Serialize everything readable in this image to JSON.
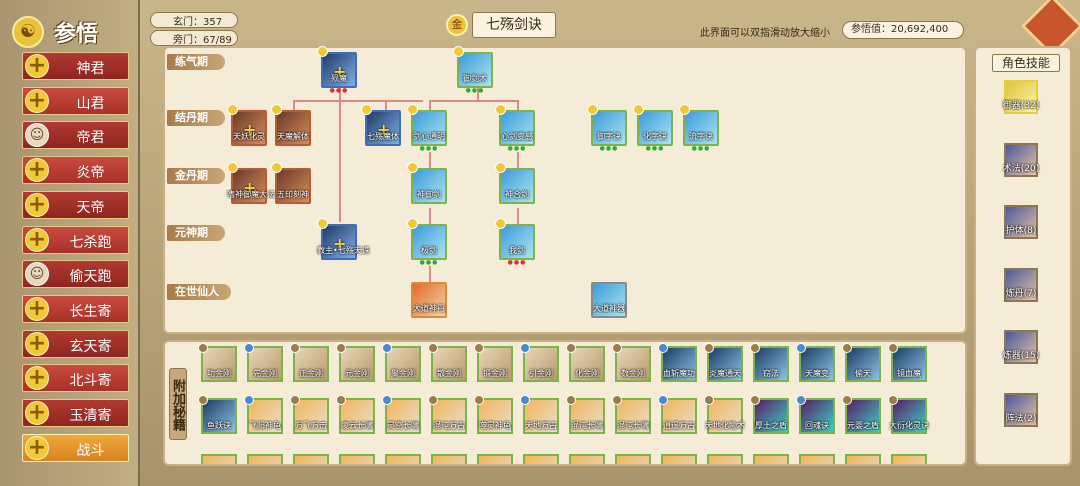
{
  "sidebar": {
    "title": "参悟",
    "items": [
      {
        "label": "神君",
        "icon": "plus-icon"
      },
      {
        "label": "山君",
        "icon": "plus-icon"
      },
      {
        "label": "帝君",
        "icon": "avatar-icon"
      },
      {
        "label": "炎帝",
        "icon": "plus-icon"
      },
      {
        "label": "天帝",
        "icon": "plus-icon"
      },
      {
        "label": "七杀跑",
        "icon": "plus-icon"
      },
      {
        "label": "偷天跑",
        "icon": "avatar-icon"
      },
      {
        "label": "长生寄",
        "icon": "plus-icon"
      },
      {
        "label": "玄天寄",
        "icon": "plus-icon"
      },
      {
        "label": "北斗寄",
        "icon": "plus-icon"
      },
      {
        "label": "玉清寄",
        "icon": "plus-icon"
      },
      {
        "label": "战斗",
        "icon": "plus-icon",
        "active": true
      }
    ]
  },
  "header": {
    "xuanmen": "玄门：357",
    "pangmen": "旁门：67/89",
    "coin_label": "金",
    "title": "七殇剑诀",
    "hint": "此界面可以双指滑动放大缩小",
    "wudao": "参悟值：20,692,400"
  },
  "tree": {
    "tiers": [
      "练气期",
      "结丹期",
      "金丹期",
      "元神期",
      "在世仙人"
    ],
    "nodes": {
      "n1": "殒魔",
      "n2": "御剑术",
      "n3": "天妖化灵",
      "n4": "天魔解体",
      "n5": "七殇魔体",
      "n6": "剑心通明",
      "n7": "心剑变感",
      "n8": "御字诀",
      "n9": "化字诀",
      "n10": "流字诀",
      "n11": "嗜神御魔大法",
      "n12": "五印刻神",
      "n13": "神御剑",
      "n14": "神合剑",
      "n15": "教主•七殇天诛",
      "n16": "极剑",
      "n17": "我剑",
      "n18": "大道神丹",
      "n19": "大道神器"
    }
  },
  "right_panel": {
    "title": "角色技能",
    "skills": [
      {
        "label": "御器(32)",
        "selected": true
      },
      {
        "label": "术法(20)"
      },
      {
        "label": "护体(8)"
      },
      {
        "label": "炼丹(7)"
      },
      {
        "label": "炼器(15)"
      },
      {
        "label": "阵法(2)"
      }
    ]
  },
  "bottom": {
    "tab": "附加秘籍",
    "row1": [
      "功金刚",
      "先金刚",
      "正金刚",
      "元金刚",
      "聚金刚",
      "散金刚",
      "锻金刚",
      "引金刚",
      "化金刚",
      "数金刚",
      "血斩魔功",
      "炎魔通天",
      "窃法",
      "天魔变",
      "偷天",
      "镜血魔"
    ],
    "row2": [
      "鱼跃诀",
      "飞阳神龟",
      "万飞万击",
      "凌云长啸",
      "灵空长啸",
      "混沌万古",
      "噬灵神龟",
      "天地万古",
      "混沌长啸",
      "混沌长啸",
      "逍遥万古",
      "天地化物术",
      "厚土之盾",
      "回魂诀",
      "元婴之盾",
      "大衍化灵诀"
    ]
  }
}
